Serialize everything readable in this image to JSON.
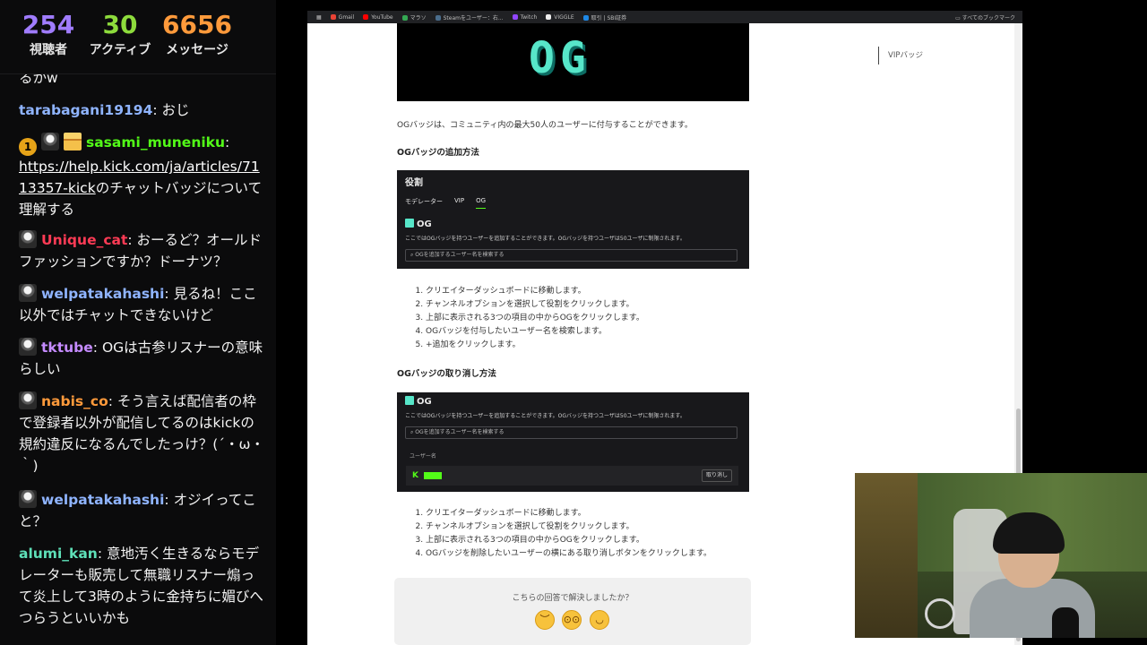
{
  "stats": {
    "viewers": {
      "value": "254",
      "label": "視聴者"
    },
    "active": {
      "value": "30",
      "label": "アクティブ"
    },
    "messages": {
      "value": "6656",
      "label": "メッセージ"
    }
  },
  "chat": {
    "messages": [
      {
        "text": "るかw"
      },
      {
        "user": "tarabagani19194",
        "user_color": "#8fb4ff",
        "text": "おじ"
      },
      {
        "user": "sasami_muneniku",
        "user_color": "#53fc18",
        "badges": [
          "gold-badge",
          "subscriber-badge",
          "gift-badge"
        ],
        "link": "https://help.kick.com/ja/articles/7113357-kick",
        "text": "のチャットバッジについて理解する"
      },
      {
        "user": "Unique_cat",
        "user_color": "#ff3b55",
        "badges": [
          "subscriber-badge"
        ],
        "text": "おーるど？オールドファッションですか？ドーナツ？"
      },
      {
        "user": "welpatakahashi",
        "user_color": "#8fb4ff",
        "badges": [
          "subscriber-badge"
        ],
        "text": "見るね！ここ以外ではチャットできないけど"
      },
      {
        "user": "tktube",
        "user_color": "#c58bff",
        "badges": [
          "subscriber-badge"
        ],
        "text": "OGは古参リスナーの意味らしい"
      },
      {
        "user": "nabis_co",
        "user_color": "#ff9a3b",
        "badges": [
          "subscriber-badge"
        ],
        "text": "そう言えば配信者の枠で登録者以外が配信してるのはkickの規約違反になるんでしたっけ？(´・ω・｀)"
      },
      {
        "user": "welpatakahashi",
        "user_color": "#8fb4ff",
        "badges": [
          "subscriber-badge"
        ],
        "text": "オジイってこと？"
      },
      {
        "user": "alumi_kan",
        "user_color": "#5ee0b8",
        "text": "意地汚く生きるならモデレーターも販売して無職リスナー煽って炎上して3時のように金持ちに媚びへつらうといいかも"
      }
    ]
  },
  "browser": {
    "bookmarks": [
      "Gmail",
      "YouTube",
      "マラソ",
      "Steamをユーザー：右...",
      "Twitch",
      "VIGGLE",
      "取引 | SBI証券"
    ],
    "all_bookmarks": "すべてのブックマーク",
    "toc_item": "VIPバッジ",
    "og_logo_text": "OG",
    "intro": "OGバッジは、コミュニティ内の最大50人のユーザーに付与することができます。",
    "add_heading": "OGバッジの追加方法",
    "shot1": {
      "title": "役割",
      "tabs": [
        "モデレーター",
        "VIP",
        "OG"
      ],
      "og_title": "OG",
      "desc": "ここではOGバッジを持つユーザーを追加することができます。OGバッジを持つユーザは50ユーザに制限されます。",
      "search_placeholder": "OGを追加するユーザー名を検索する"
    },
    "add_steps": [
      "クリエイターダッシュボードに移動します。",
      "チャンネルオプションを選択して役割をクリックします。",
      "上部に表示される3つの項目の中からOGをクリックします。",
      "OGバッジを付与したいユーザー名を検索します。",
      "+追加をクリックします。"
    ],
    "remove_heading": "OGバッジの取り消し方法",
    "shot2": {
      "og_title": "OG",
      "desc": "ここではOGバッジを持つユーザーを追加することができます。OGバッジを持つユーザは50ユーザに制限されます。",
      "search_placeholder": "OGを追加するユーザー名を検索する",
      "column_header": "ユーザー名",
      "remove_button": "取り消し"
    },
    "remove_steps": [
      "クリエイターダッシュボードに移動します。",
      "チャンネルオプションを選択して役割をクリックします。",
      "上部に表示される3つの項目の中からOGをクリックします。",
      "OGバッジを削除したいユーザーの横にある取り消しボタンをクリックします。"
    ],
    "feedback": {
      "question": "こちらの回答で解決しましたか？",
      "options": [
        "disappointed-face-icon",
        "neutral-face-icon",
        "smiling-face-icon"
      ]
    }
  }
}
